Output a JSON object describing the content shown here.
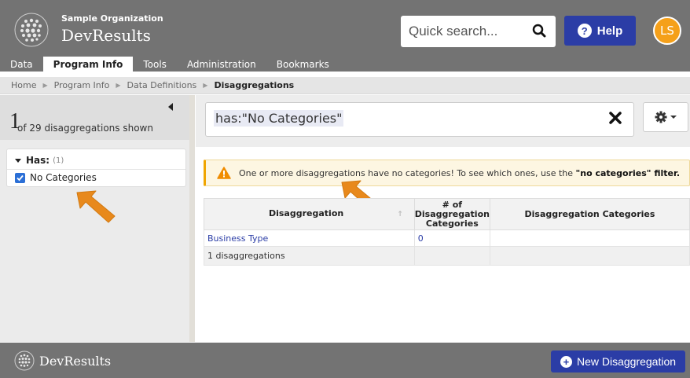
{
  "header": {
    "org_name": "Sample Organization",
    "app_name": "DevResults",
    "search_placeholder": "Quick search...",
    "help_label": "Help",
    "avatar_initials": "LS",
    "nav": [
      "Data",
      "Program Info",
      "Tools",
      "Administration",
      "Bookmarks"
    ],
    "active_nav": "Program Info"
  },
  "breadcrumb": [
    "Home",
    "Program Info",
    "Data Definitions",
    "Disaggregations"
  ],
  "sidebar": {
    "count_number": "1",
    "count_text": "of 29 disaggregations shown",
    "filter_title": "Has:",
    "filter_count": "(1)",
    "filter_option": "No Categories"
  },
  "main": {
    "query": "has:\"No Categories\"",
    "alert_prefix": "One or more disaggregations have no categories! To see which ones, use the ",
    "alert_bold": "\"no categories\" filter.",
    "columns": [
      "Disaggregation",
      "# of Disaggregation Categories",
      "Disaggregation Categories"
    ],
    "rows": [
      {
        "name": "Business Type",
        "count": "0",
        "categories": ""
      }
    ],
    "total_label": "1 disaggregations"
  },
  "footer": {
    "logo_text": "DevResults",
    "new_button": "New Disaggregation"
  },
  "colors": {
    "header_bg": "#737373",
    "accent_blue": "#2b3da6",
    "avatar_orange": "#f5a01a",
    "annotation_arrow": "#e8891c"
  }
}
